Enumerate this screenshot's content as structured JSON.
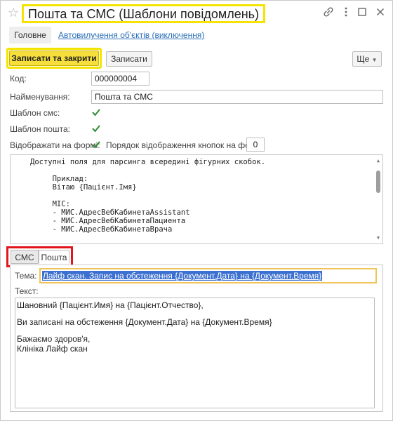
{
  "window": {
    "title": "Пошта та СМС (Шаблони повідомлень)",
    "icons": [
      "star-icon",
      "link-icon",
      "more-vert-icon",
      "minimize-icon",
      "maximize-icon",
      "close-icon"
    ]
  },
  "nav": {
    "main": "Головне",
    "link": "Автовилучення об'єктів (виключення)"
  },
  "toolbar": {
    "save_close": "Записати та закрити",
    "save": "Записати",
    "more": "Ще"
  },
  "form": {
    "code_label": "Код:",
    "code_value": "000000004",
    "name_label": "Найменування:",
    "name_value": "Пошта та СМС",
    "sms_template_label": "Шаблон смс:",
    "sms_template_checked": true,
    "mail_template_label": "Шаблон пошта:",
    "mail_template_checked": true,
    "show_on_form_label": "Відображати на формі:",
    "show_on_form_checked": true,
    "order_label": "Порядок відображення кнопок на формі:",
    "order_value": "0"
  },
  "code_area": {
    "lines": [
      "Доступні поля для парсингa всередині фігурних скобок.",
      "",
      "     Приклад:",
      "     Вітаю {Пацієнт.Імя}",
      "",
      "     МІС:",
      "     - МИС.АдресВебКабинетаAssistant",
      "     - МИС.АдресВебКабинетаПациента",
      "     - МИС.АдресВебКабинетаВрача"
    ]
  },
  "tabs": {
    "items": [
      "СМС",
      "Пошта"
    ],
    "active": "Пошта"
  },
  "mail": {
    "subject_label": "Тема:",
    "subject_value": "Лайф скан. Запис на обстеження {Документ.Дата} на {Документ.Время}",
    "text_label": "Текст:",
    "text_lines": [
      "Шановний {Пацієнт.Имя} на {Пацієнт.Отчество},",
      "",
      "Ви записані на обстеження {Документ.Дата} на {Документ.Время}",
      "",
      "Бажаємо здоров'я,",
      "Клініка Лайф скан"
    ]
  },
  "colors": {
    "highlight_yellow": "#f5e400",
    "highlight_red": "#e2151c",
    "primary_button": "#f6df3c",
    "link_blue": "#2a6db7",
    "check_green": "#2f8a2f",
    "selection_blue": "#3b6fd0"
  }
}
